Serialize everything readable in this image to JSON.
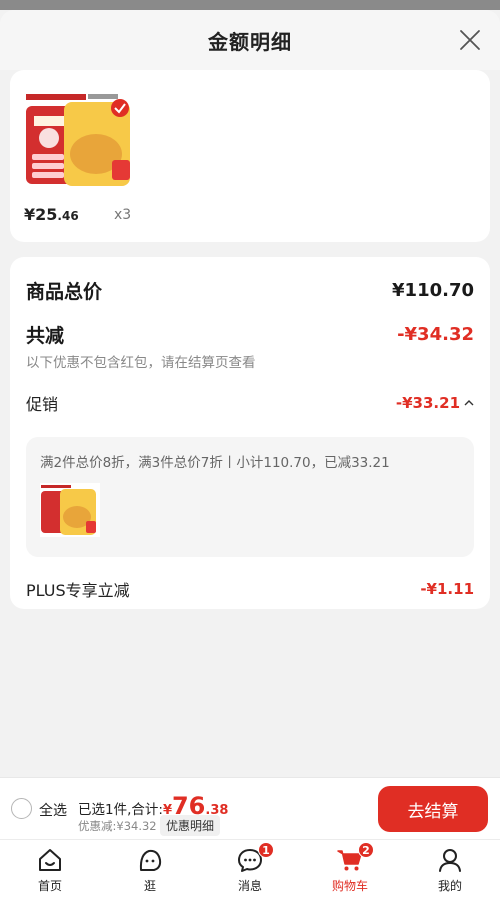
{
  "sheet": {
    "title": "金额明细"
  },
  "product": {
    "price_int": "¥25",
    "price_dec": ".46",
    "quantity": "x3"
  },
  "breakdown": {
    "total_label": "商品总价",
    "total_value": "¥110.70",
    "reduce_label": "共减",
    "reduce_value": "-¥34.32",
    "note": "以下优惠不包含红包，请在结算页查看",
    "promo_label": "促销",
    "promo_value": "-¥33.21",
    "promo_detail": "满2件总价8折，满3件总价7折丨小计110.70，已减33.21",
    "plus_label": "PLUS专享立减",
    "plus_value": "-¥1.11"
  },
  "footer": {
    "select_all": "全选",
    "summary_prefix": "已选1件,合计:",
    "total_yen": "¥",
    "total_int": "76",
    "total_dec": ".38",
    "discount": "优惠减:¥34.32",
    "detail_button": "优惠明细",
    "checkout_button": "去结算"
  },
  "tabs": [
    {
      "label": "首页",
      "icon": "home-icon"
    },
    {
      "label": "逛",
      "icon": "explore-icon"
    },
    {
      "label": "消息",
      "icon": "message-icon",
      "badge": "1"
    },
    {
      "label": "购物车",
      "icon": "cart-icon",
      "badge": "2"
    },
    {
      "label": "我的",
      "icon": "profile-icon"
    }
  ],
  "colors": {
    "accent": "#e02e24",
    "background": "#f2f2f2"
  }
}
